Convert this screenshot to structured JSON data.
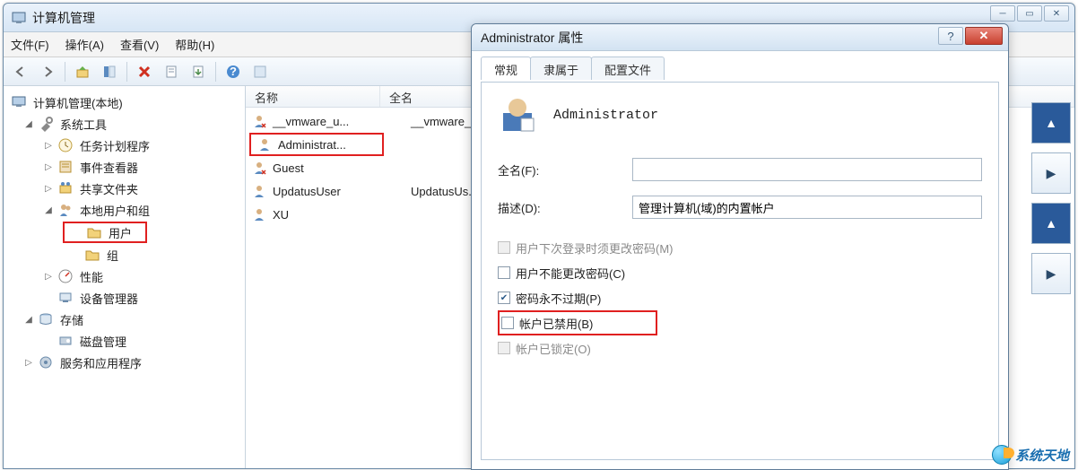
{
  "mainWindow": {
    "title": "计算机管理",
    "menu": {
      "file": "文件(F)",
      "action": "操作(A)",
      "view": "查看(V)",
      "help": "帮助(H)"
    }
  },
  "tree": {
    "root": "计算机管理(本地)",
    "systemTools": "系统工具",
    "taskScheduler": "任务计划程序",
    "eventViewer": "事件查看器",
    "sharedFolders": "共享文件夹",
    "localUsersGroups": "本地用户和组",
    "users": "用户",
    "groups": "组",
    "performance": "性能",
    "deviceManager": "设备管理器",
    "storage": "存储",
    "diskManagement": "磁盘管理",
    "servicesApps": "服务和应用程序"
  },
  "list": {
    "colName": "名称",
    "colFullName": "全名",
    "rows": [
      {
        "name": "__vmware_u...",
        "full": "__vmware_u..."
      },
      {
        "name": "Administrat...",
        "full": ""
      },
      {
        "name": "Guest",
        "full": ""
      },
      {
        "name": "UpdatusUser",
        "full": "UpdatusUs..."
      },
      {
        "name": "XU",
        "full": ""
      }
    ]
  },
  "dialog": {
    "title": "Administrator 属性",
    "tabs": {
      "general": "常规",
      "memberOf": "隶属于",
      "profile": "配置文件"
    },
    "userName": "Administrator",
    "fullNameLabel": "全名(F):",
    "fullNameValue": "",
    "descLabel": "描述(D):",
    "descValue": "管理计算机(域)的内置帐户",
    "chkMustChange": "用户下次登录时须更改密码(M)",
    "chkCannotChange": "用户不能更改密码(C)",
    "chkNeverExpire": "密码永不过期(P)",
    "chkDisabled": "帐户已禁用(B)",
    "chkLocked": "帐户已锁定(O)"
  },
  "watermark": "系统天地"
}
